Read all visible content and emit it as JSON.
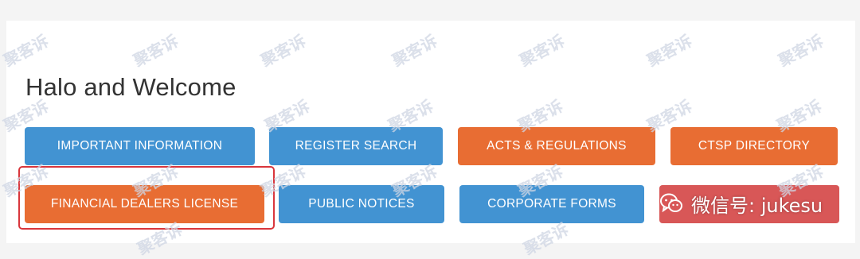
{
  "page": {
    "heading": "Halo and Welcome"
  },
  "buttons": [
    {
      "label": "IMPORTANT INFORMATION"
    },
    {
      "label": "REGISTER SEARCH"
    },
    {
      "label": "ACTS & REGULATIONS"
    },
    {
      "label": "CTSP DIRECTORY"
    },
    {
      "label": "FINANCIAL DEALERS LICENSE"
    },
    {
      "label": "PUBLIC NOTICES"
    },
    {
      "label": "CORPORATE FORMS"
    },
    {
      "label": ""
    }
  ],
  "colors": {
    "blue": "#4293d2",
    "orange": "#e86d33",
    "red": "#d85757",
    "highlight_border": "#d9363c"
  },
  "watermark": {
    "text": "聚客诉"
  },
  "overlay": {
    "wechat_text": "微信号: jukesu",
    "icon": "wechat-icon"
  }
}
